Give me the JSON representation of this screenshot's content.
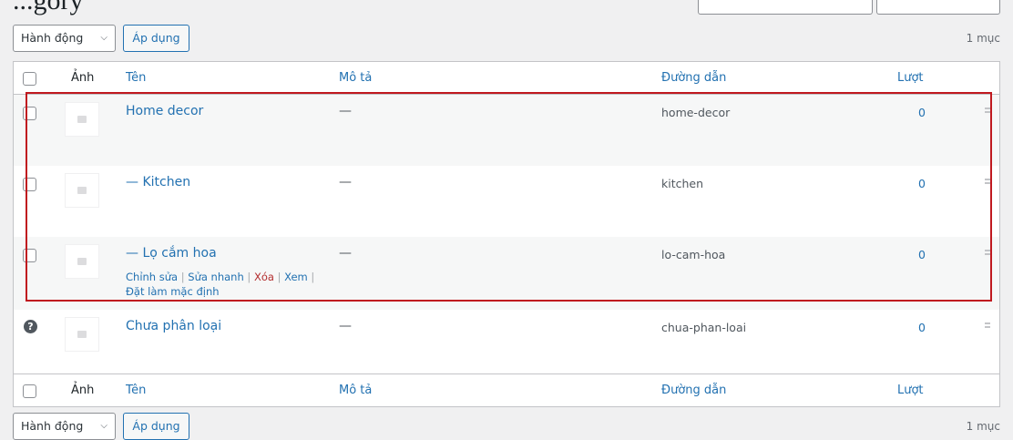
{
  "page": {
    "heading_partial": "...gory"
  },
  "bulk": {
    "action_label": "Hành động",
    "apply_label": "Áp dụng",
    "count": "1 mục"
  },
  "columns": {
    "image": "Ảnh",
    "name": "Tên",
    "description": "Mô tả",
    "slug": "Đường dẫn",
    "count": "Lượt"
  },
  "rows": [
    {
      "name": "Home decor",
      "description": "—",
      "slug": "home-decor",
      "count": "0"
    },
    {
      "name": "— Kitchen",
      "description": "—",
      "slug": "kitchen",
      "count": "0"
    },
    {
      "name": "— Lọ cắm hoa",
      "description": "—",
      "slug": "lo-cam-hoa",
      "count": "0",
      "actions": {
        "edit": "Chỉnh sửa",
        "quick_edit": "Sửa nhanh",
        "delete": "Xóa",
        "view": "Xem",
        "make_default": "Đặt làm mặc định"
      }
    },
    {
      "name": "Chưa phân loại",
      "description": "—",
      "slug": "chua-phan-loai",
      "count": "0",
      "icon": "help-icon"
    }
  ],
  "colors": {
    "link": "#2271b1",
    "highlight": "#c0191f",
    "delete": "#b32d2e"
  }
}
